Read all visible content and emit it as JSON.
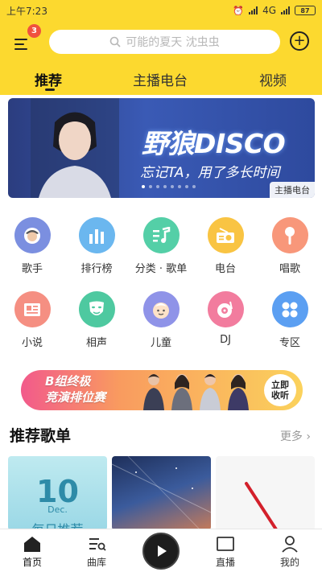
{
  "status_bar": {
    "time": "上午7:23",
    "network": "4G",
    "battery": "87"
  },
  "header": {
    "badge_count": "3",
    "search_placeholder": "可能的夏天 沈虫虫"
  },
  "tabs": [
    {
      "label": "推荐",
      "active": true
    },
    {
      "label": "主播电台",
      "active": false
    },
    {
      "label": "视频",
      "active": false
    }
  ],
  "banner": {
    "title": "野狼DISCO",
    "subtitle": "忘记TA，用了多长时间",
    "tag": "主播电台"
  },
  "grid": [
    {
      "label": "歌手",
      "icon": "singer-icon",
      "color": "#7b8fe0"
    },
    {
      "label": "排行榜",
      "icon": "chart-icon",
      "color": "#6bb7ef"
    },
    {
      "label": "分类 · 歌单",
      "icon": "playlist-icon",
      "color": "#54cfa7"
    },
    {
      "label": "电台",
      "icon": "radio-icon",
      "color": "#f9c443"
    },
    {
      "label": "唱歌",
      "icon": "mic-icon",
      "color": "#f8977a"
    },
    {
      "label": "小说",
      "icon": "book-icon",
      "color": "#f58f82"
    },
    {
      "label": "相声",
      "icon": "mask-icon",
      "color": "#4ec9a0"
    },
    {
      "label": "儿童",
      "icon": "child-icon",
      "color": "#8f93e8"
    },
    {
      "label": "DJ",
      "icon": "dj-icon",
      "color": "#f27c9e"
    },
    {
      "label": "专区",
      "icon": "zone-icon",
      "color": "#5b9ff2"
    }
  ],
  "promo": {
    "line1": "B组终极",
    "line2": "竞演排位赛",
    "button_line1": "立即",
    "button_line2": "收听"
  },
  "section": {
    "title": "推荐歌单",
    "more": "更多"
  },
  "cards": {
    "card1_day": "10",
    "card1_month": "Dec.",
    "card1_tag": "每日推荐"
  },
  "bottom_nav": [
    {
      "label": "首页",
      "icon": "home-icon"
    },
    {
      "label": "曲库",
      "icon": "library-icon"
    },
    {
      "label": "直播",
      "icon": "live-icon"
    },
    {
      "label": "我的",
      "icon": "profile-icon"
    }
  ]
}
